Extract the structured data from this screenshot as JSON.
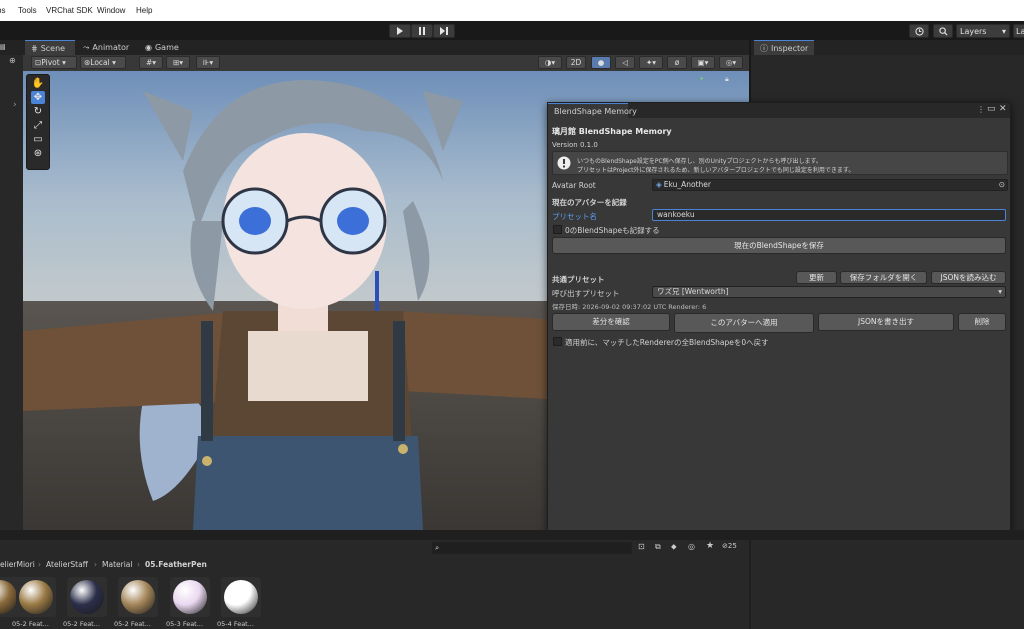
{
  "menubar": {
    "items": [
      "bs",
      "Tools",
      "VRChat SDK",
      "Window",
      "Help"
    ]
  },
  "toolbar": {
    "play_icon": "play-icon",
    "pause_icon": "pause-icon",
    "step_icon": "step-icon",
    "layers_label": "Layers",
    "layout_label": "La"
  },
  "scene": {
    "tabs": [
      "Scene",
      "Animator",
      "Game"
    ],
    "pivot_label": "Pivot",
    "local_label": "Local",
    "mode_2d": "2D"
  },
  "inspector": {
    "tab_label": "Inspector"
  },
  "dialog": {
    "tab_title": "BlendShape Memory",
    "title": "璃月館 BlendShape Memory",
    "version": "Version 0.1.0",
    "info_line1": "いつものBlendShape設定をPC側へ保存し、別のUnityプロジェクトからも呼び出します。",
    "info_line2": "プリセットはProject外に保存されるため、新しいアバタープロジェクトでも同じ設定を利用できます。",
    "avatar_root_label": "Avatar Root",
    "avatar_root_value": "Eku_Another",
    "record_section": "現在のアバターを記録",
    "preset_name_label": "プリセット名",
    "preset_name_value": "wankoeku",
    "record_zero_label": "0のBlendShapeも記録する",
    "save_button": "現在のBlendShapeを保存",
    "shared_section": "共通プリセット",
    "refresh_button": "更新",
    "open_folder_button": "保存フォルダを開く",
    "import_json_button": "JSONを読み込む",
    "load_preset_label": "呼び出すプリセット",
    "load_preset_value": "ワズ兄 [Wentworth]",
    "saved_info": "保存日時: 2026-09-02 09:37:02 UTC    Renderer: 6",
    "diff_button": "差分を確認",
    "apply_button": "このアバターへ適用",
    "export_json_button": "JSONを書き出す",
    "delete_button": "削除",
    "reset_option_label": "適用前に、マッチしたRendererの全BlendShapeを0へ戻す"
  },
  "project": {
    "breadcrumb": [
      "elierMiori",
      "AtelierStaff",
      "Material",
      "05.FeatherPen"
    ],
    "hidden_count": "25",
    "assets": [
      {
        "label": "",
        "color": "#8a6a3a"
      },
      {
        "label": "05-2 Feat...",
        "color": "#9a7a45"
      },
      {
        "label": "05-2 Feat...",
        "color": "#2b2f4a"
      },
      {
        "label": "05-2 Feat...",
        "color": "#a4865a"
      },
      {
        "label": "05-3 Feat...",
        "color": "#ead8f0"
      },
      {
        "label": "05-4 Feat...",
        "color": "#ffffff"
      }
    ]
  },
  "colors": {
    "accent_blue": "#4b84d6",
    "link_blue": "#5aa0f0",
    "panel": "#383838"
  }
}
